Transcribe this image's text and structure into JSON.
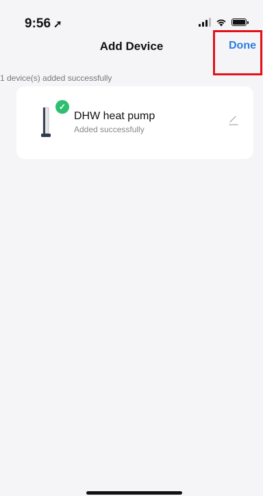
{
  "status_bar": {
    "time": "9:56",
    "location_icon": "location-arrow-icon",
    "icons": [
      "signal-icon",
      "wifi-icon",
      "battery-icon"
    ]
  },
  "header": {
    "title": "Add Device",
    "done_label": "Done"
  },
  "summary": "1 device(s) added successfully",
  "devices": [
    {
      "name": "DHW heat pump",
      "status": "Added successfully",
      "badge_icon": "check-icon",
      "action_icon": "edit-icon"
    }
  ],
  "colors": {
    "accent": "#2a7de1",
    "success": "#2fbf71",
    "highlight": "#e3101a",
    "background": "#f5f5f7"
  }
}
